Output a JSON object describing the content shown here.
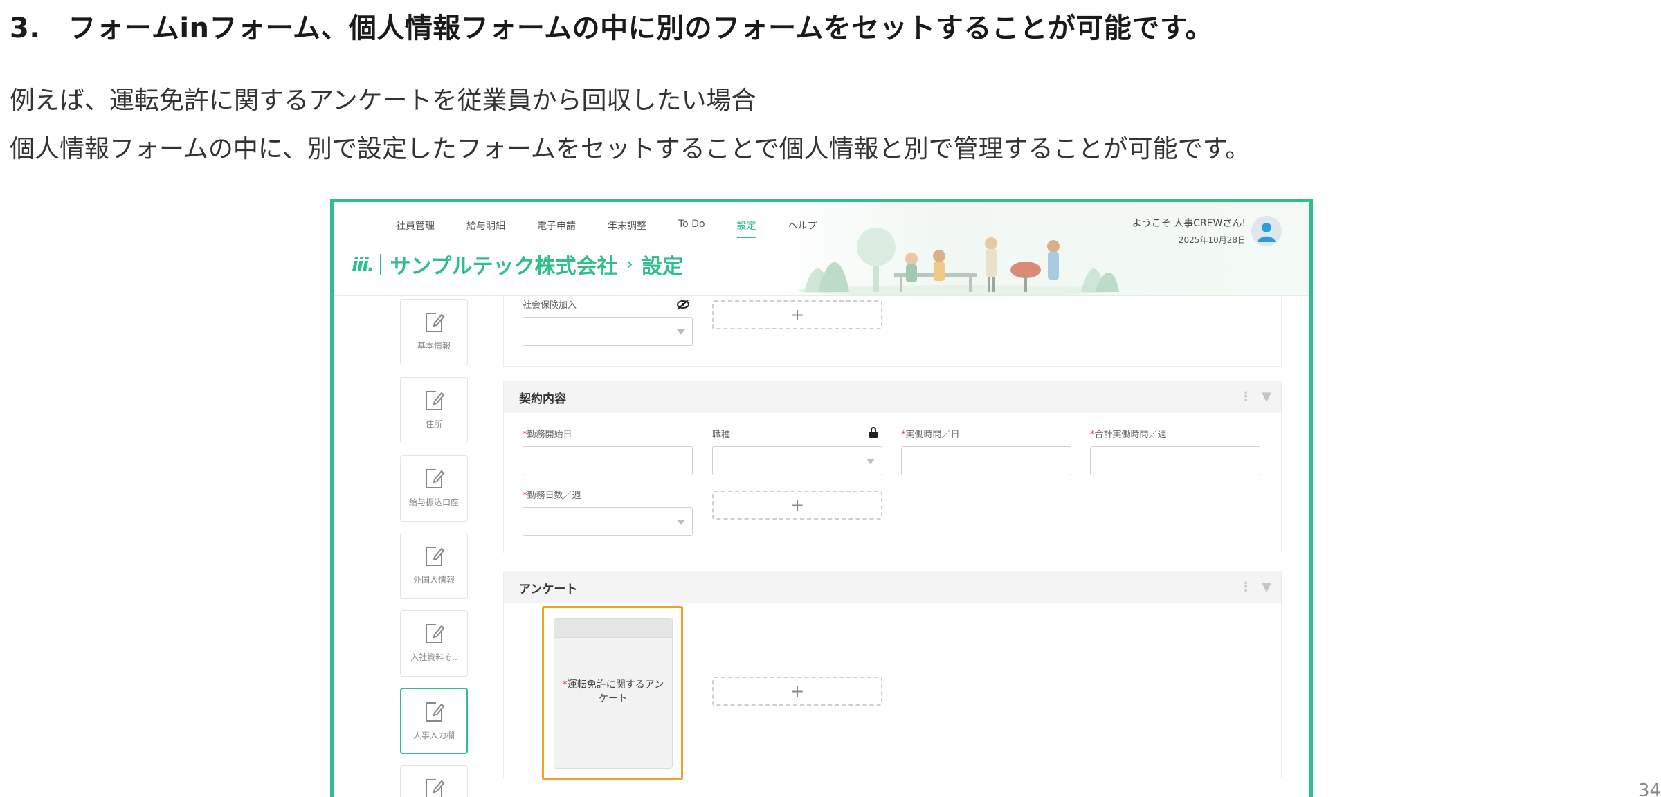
{
  "slide": {
    "heading": "3.　フォームinフォーム、個人情報フォームの中に別のフォームをセットすることが可能です。",
    "paragraph1": "例えば、運転免許に関するアンケートを従業員から回収したい場合",
    "paragraph2": "個人情報フォームの中に、別で設定したフォームをセットすることで個人情報と別で管理することが可能です。",
    "page_number": "34"
  },
  "app": {
    "nav": [
      {
        "label": "社員管理"
      },
      {
        "label": "給与明細"
      },
      {
        "label": "電子申請"
      },
      {
        "label": "年末調整"
      },
      {
        "label": "To Do"
      },
      {
        "label": "設定",
        "active": true
      },
      {
        "label": "ヘルプ"
      }
    ],
    "logo": "iii.",
    "company": "サンプルテック株式会社",
    "breadcrumb_sep": "›",
    "page": "設定",
    "greeting": "ようこそ 人事CREWさん!",
    "date": "2025年10月28日"
  },
  "sidebar": {
    "items": [
      {
        "label": "基本情報"
      },
      {
        "label": "住所"
      },
      {
        "label": "給与振込口座"
      },
      {
        "label": "外国人情報"
      },
      {
        "label": "入社資料そ.."
      },
      {
        "label": "人事入力欄",
        "active": true
      },
      {
        "label": ""
      }
    ]
  },
  "cards": {
    "top": {
      "field_label": "社会保険加入",
      "add": "+"
    },
    "contract": {
      "title": "契約内容",
      "tools": [
        "⋮",
        "▼"
      ],
      "fields": [
        {
          "label": "勤務開始日",
          "required": true
        },
        {
          "label": "職種",
          "required": false
        },
        {
          "label": "実働時間／日",
          "required": true
        },
        {
          "label": "合計実働時間／週",
          "required": true
        },
        {
          "label": "勤務日数／週",
          "required": true
        }
      ],
      "add": "+"
    },
    "survey": {
      "title": "アンケート",
      "tools": [
        "⋮",
        "▼"
      ],
      "nested_form_title": "運転免許に関するアンケート",
      "add": "+"
    }
  },
  "colors": {
    "accent": "#2fbf8a",
    "highlight": "#f0a12a",
    "required": "#e0342f"
  }
}
